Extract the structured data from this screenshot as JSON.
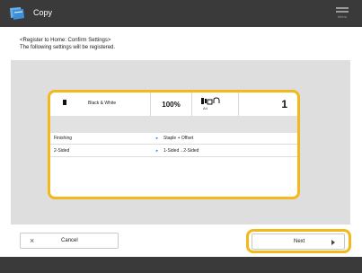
{
  "app": {
    "title": "Copy",
    "icon": "copy-app-icon",
    "menu_icon": "menu-icon",
    "menu_label": "Menu"
  },
  "instructions": {
    "line1": "<Register to Home: Confirm Settings>",
    "line2": "The following settings will be registered."
  },
  "summary": {
    "color_mode": "Black & White",
    "color_icon": "black-square-icon",
    "zoom": "100%",
    "paper": "A4",
    "paper_icon": "paper-source-icon",
    "copies": "1"
  },
  "settings": [
    {
      "name": "Finishing",
      "value": "Staple + Offset"
    },
    {
      "name": "2-Sided",
      "value": "1-Sided→2-Sided"
    }
  ],
  "buttons": {
    "cancel": "Cancel",
    "next": "Next"
  },
  "colors": {
    "accent": "#f2b81c",
    "header": "#3a3a3a",
    "panel": "#dedede",
    "arrow": "#2f7fd3"
  }
}
